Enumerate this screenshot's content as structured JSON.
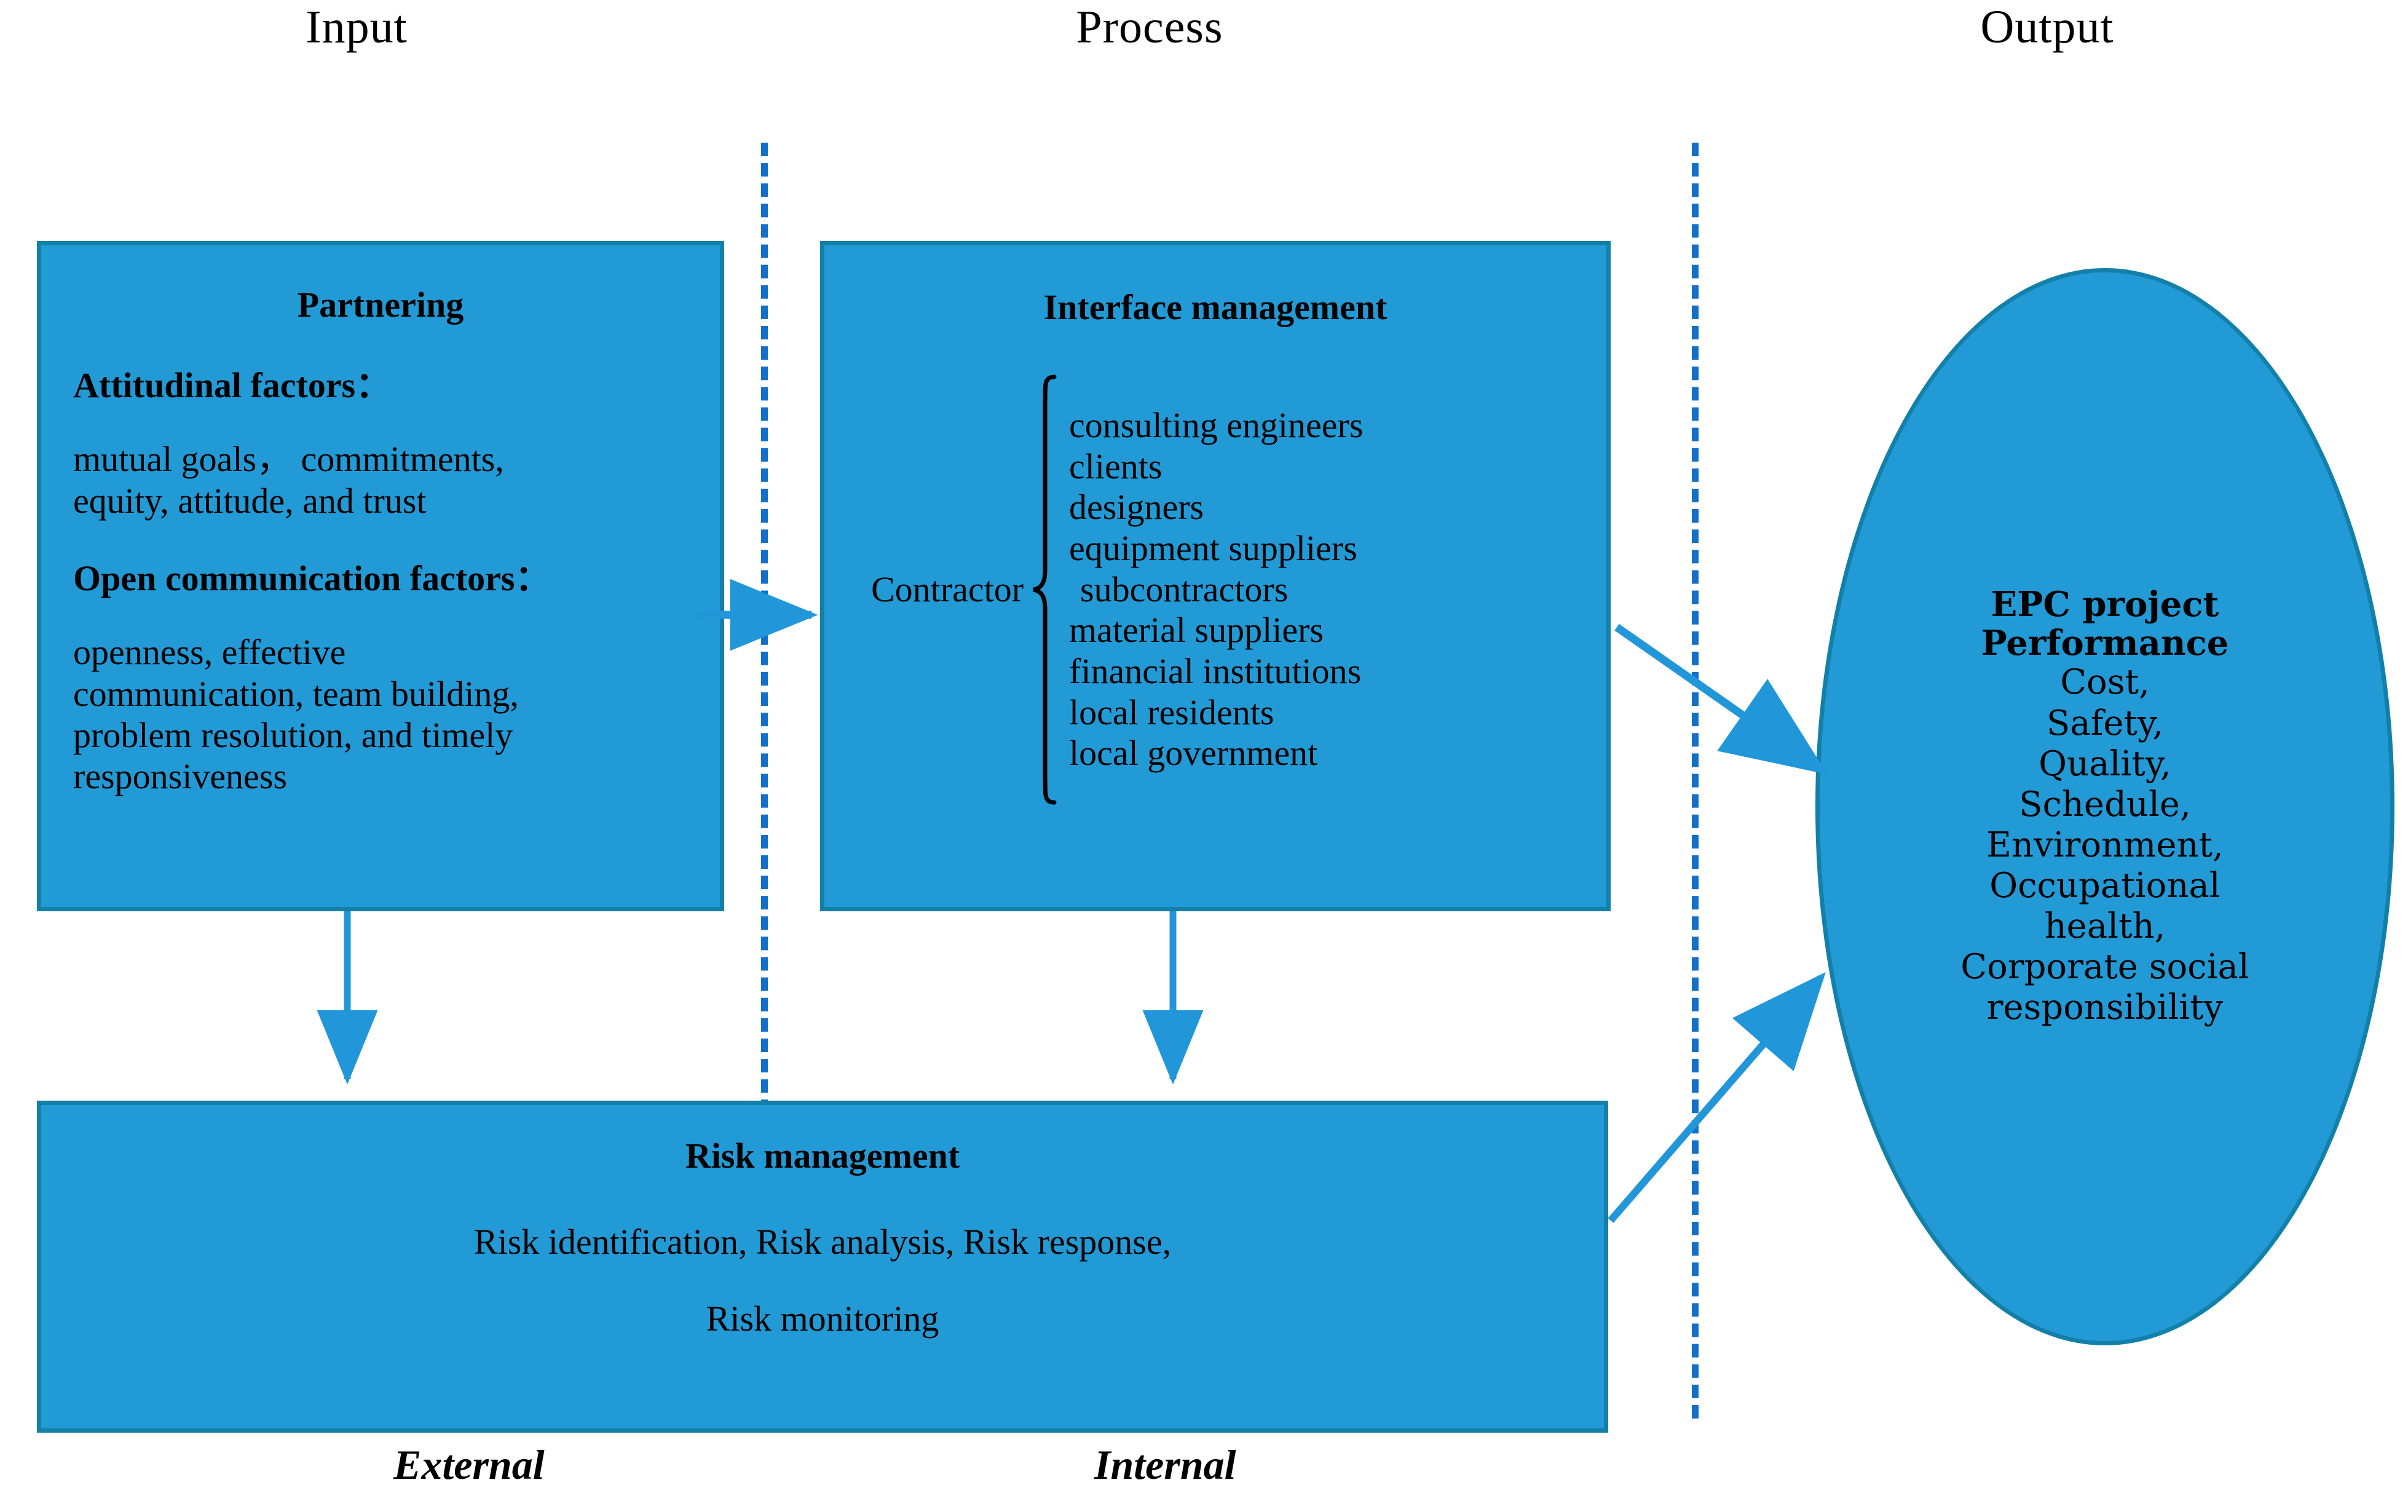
{
  "headers": {
    "input": "Input",
    "process": "Process",
    "output": "Output"
  },
  "partnering": {
    "title": "Partnering",
    "attitudinal_label": "Attitudinal factors：",
    "attitudinal_text": "mutual goals，commitments, equity, attitude, and trust",
    "attitudinal_line1": "mutual goals，  commitments,",
    "attitudinal_line2": "equity, attitude, and trust",
    "open_label": "Open communication factors：",
    "open_line1": "openness, effective",
    "open_line2": "communication, team building,",
    "open_line3": "problem resolution, and timely",
    "open_line4": "responsiveness"
  },
  "interface": {
    "title": "Interface management",
    "contractor": "Contractor",
    "stakeholders": [
      "consulting engineers",
      "clients",
      "designers",
      "equipment suppliers",
      "subcontractors",
      "material suppliers",
      "financial institutions",
      "local residents",
      "local government"
    ]
  },
  "risk": {
    "title": "Risk management",
    "line1": "Risk identification, Risk analysis, Risk response,",
    "line2": "Risk monitoring"
  },
  "output_ellipse": {
    "title_line1": "EPC project",
    "title_line2": "Performance",
    "items": [
      "Cost,",
      "Safety,",
      "Quality,",
      "Schedule,",
      "Environment,",
      "Occupational",
      "health,",
      "Corporate social",
      "responsibility"
    ]
  },
  "footers": {
    "external": "External",
    "internal": "Internal"
  },
  "colors": {
    "fill": "#229AD6",
    "stroke": "#1280A8",
    "arrow": "#2196D9",
    "dashed": "#1270C8",
    "text": "#000000",
    "background": "#FFFFFF"
  }
}
